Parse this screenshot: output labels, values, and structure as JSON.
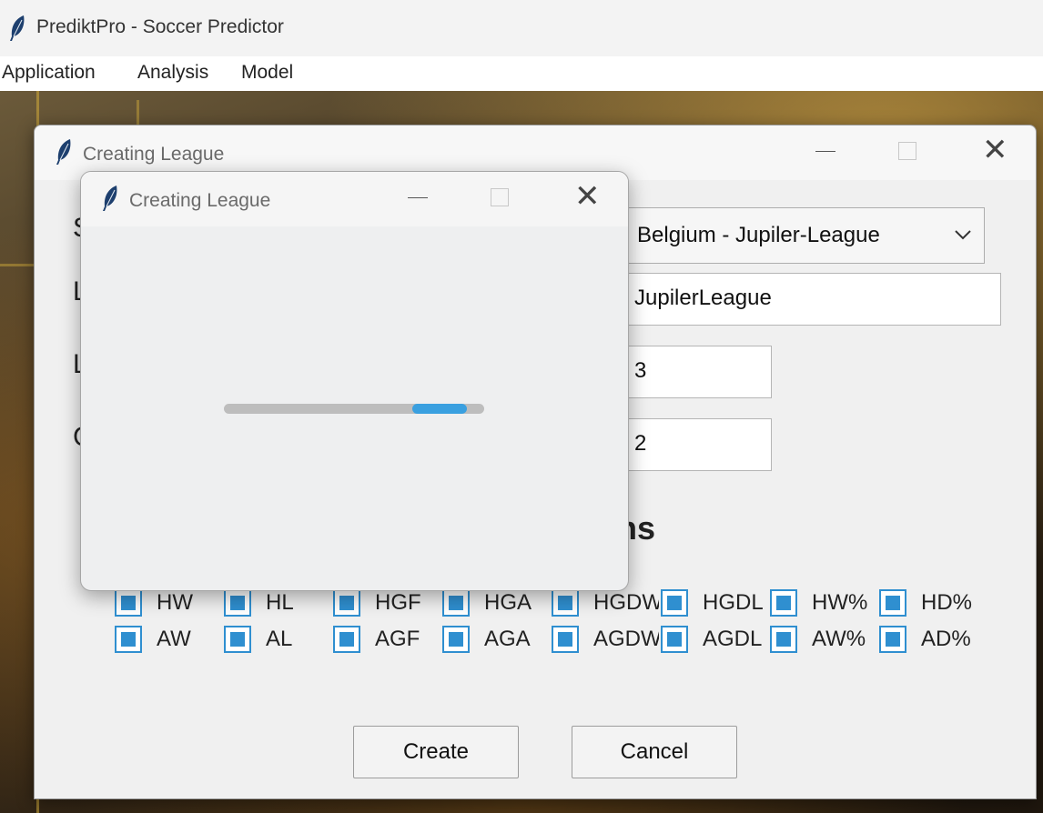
{
  "app": {
    "title": "PrediktPro - Soccer Predictor"
  },
  "menubar": {
    "items": [
      "Application",
      "Analysis",
      "Model"
    ]
  },
  "dialog": {
    "title": "Creating League",
    "row_initials": [
      "S",
      "L",
      "L",
      "C"
    ],
    "league_select": {
      "value": "Belgium - Jupiler-League"
    },
    "league_name": {
      "value": "JupilerLeague"
    },
    "field_3": {
      "value": "3"
    },
    "field_4": {
      "value": "2"
    },
    "section_fragment": "ns",
    "checkboxes_row1": [
      "HW",
      "HL",
      "HGF",
      "HGA",
      "HGDW",
      "HGDL",
      "HW%",
      "HD%"
    ],
    "checkboxes_row2": [
      "AW",
      "AL",
      "AGF",
      "AGA",
      "AGDW",
      "AGDL",
      "AW%",
      "AD%"
    ],
    "create_label": "Create",
    "cancel_label": "Cancel"
  },
  "progress_dialog": {
    "title": "Creating League",
    "mode": "indeterminate"
  },
  "colors": {
    "accent": "#2f8fd0",
    "progress_chunk": "#3aa0e0"
  }
}
